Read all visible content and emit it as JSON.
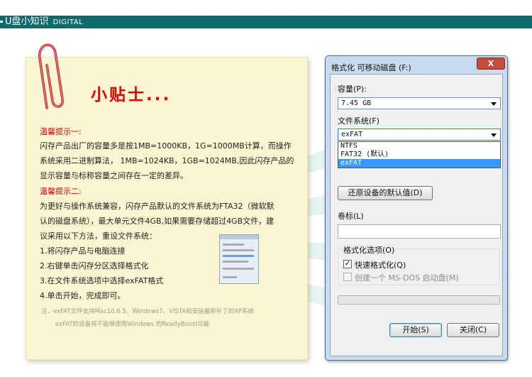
{
  "banner": {
    "title": "U盘小知识",
    "subtitle": "DIGITAL"
  },
  "note": {
    "title": "小贴士...",
    "tip1_heading": "温馨提示一:",
    "tip1_lines": [
      "闪存产品出厂的容量多是按1MB=1000KB，1G=1000MB计算，而操作",
      "系统采用二进制算法，  1MB=1024KB，1GB=1024MB,因此闪存产品的",
      "显示容量与标称容量之间存在一定的差异。"
    ],
    "tip2_heading": "温馨提示二:",
    "tip2_lines": [
      "为更好与操作系统兼容，闪存产品默认的文件系统为FTA32（微软默",
      "认的磁盘系统），最大单元文件4GB,如果需要存储超过4GB文件，建",
      "议采用以下方法，重设文件系统："
    ],
    "steps": [
      "1.将闪存产品与电脑连接",
      "2.右键单击闪存分区选择格式化",
      "3.在文件系统选项中选择exFAT格式",
      "4.单击开始，完成即可。"
    ],
    "footnote_1": "注．exFAT文件支持Mac10.6.5、Windows7、VISTA和安装最新补丁的XP系统",
    "footnote_2": "exFAT的设备将不能够使用Windows 的ReadyBoost功能"
  },
  "dialog": {
    "title": "格式化 可移动磁盘 (F:)",
    "close_label": "X",
    "capacity_label": "容量(P):",
    "capacity_value": "7.45 GB",
    "filesystem_label": "文件系统(F)",
    "filesystem_value": "exFAT",
    "filesystem_options": [
      "NTFS",
      "FAT32 (默认)",
      "exFAT"
    ],
    "restore_defaults_label": "还原设备的默认值(D)",
    "volume_label": "卷标(L)",
    "volume_value": "",
    "format_options_label": "格式化选项(O)",
    "quick_format_label": "快速格式化(Q)",
    "quick_format_checked": true,
    "msdos_label": "创建一个 MS-DOS 启动盘(M)",
    "msdos_checked": false,
    "start_label": "开始(S)",
    "close_button_label": "关闭(C)"
  }
}
